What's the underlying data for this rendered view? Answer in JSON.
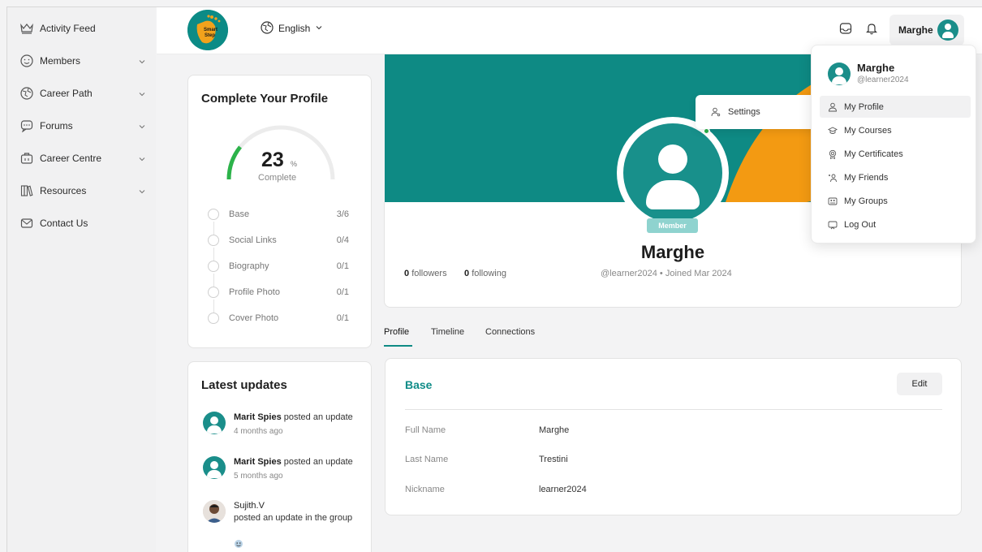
{
  "sidebar": {
    "items": [
      {
        "label": "Activity Feed",
        "icon": "crown-icon",
        "has_chevron": false
      },
      {
        "label": "Members",
        "icon": "smile-icon",
        "has_chevron": true
      },
      {
        "label": "Career Path",
        "icon": "globe-icon",
        "has_chevron": true
      },
      {
        "label": "Forums",
        "icon": "chat-icon",
        "has_chevron": true
      },
      {
        "label": "Career Centre",
        "icon": "briefcase-icon",
        "has_chevron": true
      },
      {
        "label": "Resources",
        "icon": "books-icon",
        "has_chevron": true
      },
      {
        "label": "Contact Us",
        "icon": "mail-icon",
        "has_chevron": false
      }
    ]
  },
  "topbar": {
    "logo_text": "Smart Step",
    "language": "English",
    "user_name": "Marghe"
  },
  "profile_completion": {
    "title": "Complete Your Profile",
    "percent": "23",
    "percent_sign": "%",
    "complete_label": "Complete",
    "steps": [
      {
        "name": "Base",
        "count": "3/6"
      },
      {
        "name": "Social Links",
        "count": "0/4"
      },
      {
        "name": "Biography",
        "count": "0/1"
      },
      {
        "name": "Profile Photo",
        "count": "0/1"
      },
      {
        "name": "Cover Photo",
        "count": "0/1"
      }
    ]
  },
  "latest_updates": {
    "title": "Latest updates",
    "items": [
      {
        "author": "Marit Spies",
        "action": " posted an update",
        "time": "4 months ago"
      },
      {
        "author": "Marit Spies",
        "action": " posted an update",
        "time": "5 months ago"
      },
      {
        "author": "Sujith.V",
        "action": "posted an update in the group",
        "time": ""
      }
    ]
  },
  "profile": {
    "badge": "Member",
    "name": "Marghe",
    "followers_count": "0",
    "followers_label": "followers",
    "following_count": "0",
    "following_label": "following",
    "handle_line": "@learner2024 • Joined Mar 2024"
  },
  "tabs": [
    "Profile",
    "Timeline",
    "Connections"
  ],
  "base": {
    "title": "Base",
    "edit_label": "Edit",
    "fields": [
      {
        "label": "Full Name",
        "value": "Marghe"
      },
      {
        "label": "Last Name",
        "value": "Trestini"
      },
      {
        "label": "Nickname",
        "value": "learner2024"
      }
    ]
  },
  "settings_popup": {
    "label": "Settings"
  },
  "user_menu": {
    "name": "Marghe",
    "handle": "@learner2024",
    "items": [
      {
        "label": "My Profile",
        "icon": "user-icon"
      },
      {
        "label": "My Courses",
        "icon": "graduation-cap-icon"
      },
      {
        "label": "My Certificates",
        "icon": "certificate-icon"
      },
      {
        "label": "My Friends",
        "icon": "friends-icon"
      },
      {
        "label": "My Groups",
        "icon": "groups-icon"
      },
      {
        "label": "Log Out",
        "icon": "logout-icon"
      }
    ]
  },
  "colors": {
    "accent": "#0e8a84",
    "cover_shape": "#f39a12",
    "gauge_progress": "#2cb34a"
  }
}
